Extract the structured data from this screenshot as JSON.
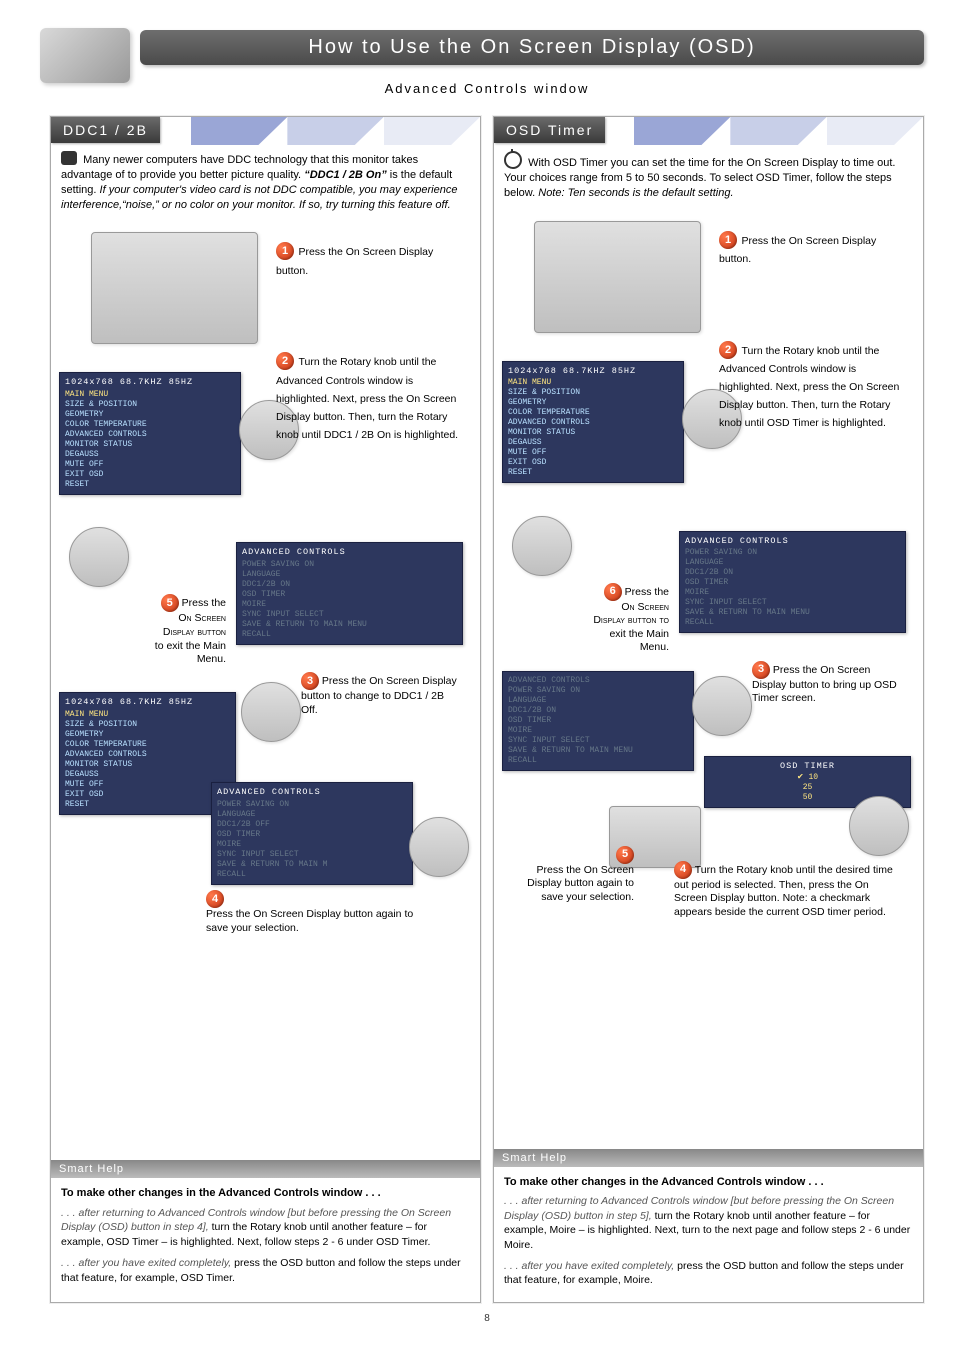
{
  "page": {
    "title_bar": "How to Use the On Screen Display (OSD)",
    "subtitle": "Advanced Controls window",
    "number": "8"
  },
  "left": {
    "heading": "DDC1 / 2B",
    "intro_a": "Many newer computers have DDC technology that this monitor takes advantage of to provide you better picture quality.",
    "intro_bold": "“DDC1 / 2B On”",
    "intro_b": " is the default setting. ",
    "intro_ital": "If your computer's video card is not DDC compatible, you may experience interference,“noise,” or no color on your monitor. If so, try turning this feature off.",
    "step1": "Press the On Screen Display button.",
    "step2": "Turn the Rotary knob until the Advanced Controls window is highlighted. Next, press the On Screen Display button. Then, turn the Rotary knob until DDC1 / 2B On is highlighted.",
    "step5_a": "Press the",
    "step5_b": "On Screen",
    "step5_c": "Display button",
    "step5_d": "to exit the Main",
    "step5_e": "Menu.",
    "step3": "Press the On Screen Display button to change to DDC1 / 2B Off.",
    "step4": "Press the On Screen Display button again to save your selection.",
    "osd_main_title": "1024x768  68.7KHZ 85HZ",
    "osd_main_sub": "MAIN MENU",
    "osd_main_items": "SIZE & POSITION\nGEOMETRY\nCOLOR TEMPERATURE\nADVANCED CONTROLS\nMONITOR STATUS\nDEGAUSS\nMUTE OFF\nEXIT OSD\nRESET",
    "osd_adv_title": "ADVANCED CONTROLS",
    "osd_adv_items_on": "POWER SAVING ON\nLANGUAGE\nDDC1/2B ON\nOSD TIMER\nMOIRE\nSYNC INPUT SELECT\nSAVE & RETURN TO MAIN MENU\nRECALL",
    "osd_adv_items_off": "POWER SAVING ON\nLANGUAGE\nDDC1/2B OFF\nOSD TIMER\nMOIRE\nSYNC INPUT SELECT\nSAVE & RETURN TO MAIN M\nRECALL",
    "smart": "Smart Help",
    "foot_lead": "To make other changes in the Advanced Controls window . . .",
    "foot_p1_a": ". . . after returning to Advanced Controls window [but before pressing the On Screen Display (OSD) button in step 4],",
    "foot_p1_b": " turn the Rotary knob until another feature – for example, OSD Timer – is highlighted. Next, follow steps 2 - 6 under OSD Timer.",
    "foot_p2_a": ". . . after you have exited completely,",
    "foot_p2_b": " press the OSD button and follow the steps under that feature, for example, OSD Timer."
  },
  "right": {
    "heading": "OSD Timer",
    "intro_a": "With OSD Timer you can set the time for the On Screen Display to time out. Your choices range from 5 to 50 seconds. To select OSD Timer, follow the steps below. ",
    "intro_ital": "Note: Ten seconds is the default setting.",
    "step1": "Press the On Screen Display button.",
    "step2": "Turn the Rotary knob until the Advanced Controls window is highlighted. Next, press the On Screen Display button. Then, turn the Rotary knob until OSD Timer is highlighted.",
    "step6_a": "Press the",
    "step6_b": "On Screen",
    "step6_c": "Display button to",
    "step6_d": "exit the Main",
    "step6_e": "Menu.",
    "step3": "Press the On Screen Display button to bring up OSD Timer screen.",
    "step5": "Press the On Screen Display button again to save your selection.",
    "step4_a": "Turn the Rotary knob until the desired time out period is selected. Then, press the On Screen Display button. ",
    "step4_ital": "Note: a checkmark appears beside the current OSD timer period.",
    "osd_adv_title": "ADVANCED CONTROLS",
    "osd_adv_items": "POWER SAVING ON\nLANGUAGE\nDDC1/2B ON\nOSD TIMER\nMOIRE\nSYNC INPUT SELECT\nSAVE & RETURN TO MAIN MENU\nRECALL",
    "osd_adv_items2": "ADVANCED CONTROLS\nPOWER SAVING ON\nLANGUAGE\nDDC1/2B ON\nOSD TIMER\nMOIRE\nSYNC INPUT SELECT\nSAVE & RETURN TO MAIN MENU\nRECALL",
    "osd_timer_title": "OSD TIMER",
    "osd_timer_items": "✔ 10\n  25\n  50",
    "smart": "Smart Help",
    "foot_lead": "To make other changes in the Advanced Controls window . . .",
    "foot_p1_a": ". . . after returning to Advanced Controls window [but before pressing the On Screen Display (OSD) button in step 5],",
    "foot_p1_b": " turn the Rotary knob until another feature – for example, Moire – is highlighted. Next, turn to the next page and follow steps 2 - 6 under Moire.",
    "foot_p2_a": ". . . after you have exited completely,",
    "foot_p2_b": " press the OSD button and follow the steps under that feature, for example, Moire."
  },
  "badges": {
    "n1": "1",
    "n2": "2",
    "n3": "3",
    "n4": "4",
    "n5": "5",
    "n6": "6"
  }
}
